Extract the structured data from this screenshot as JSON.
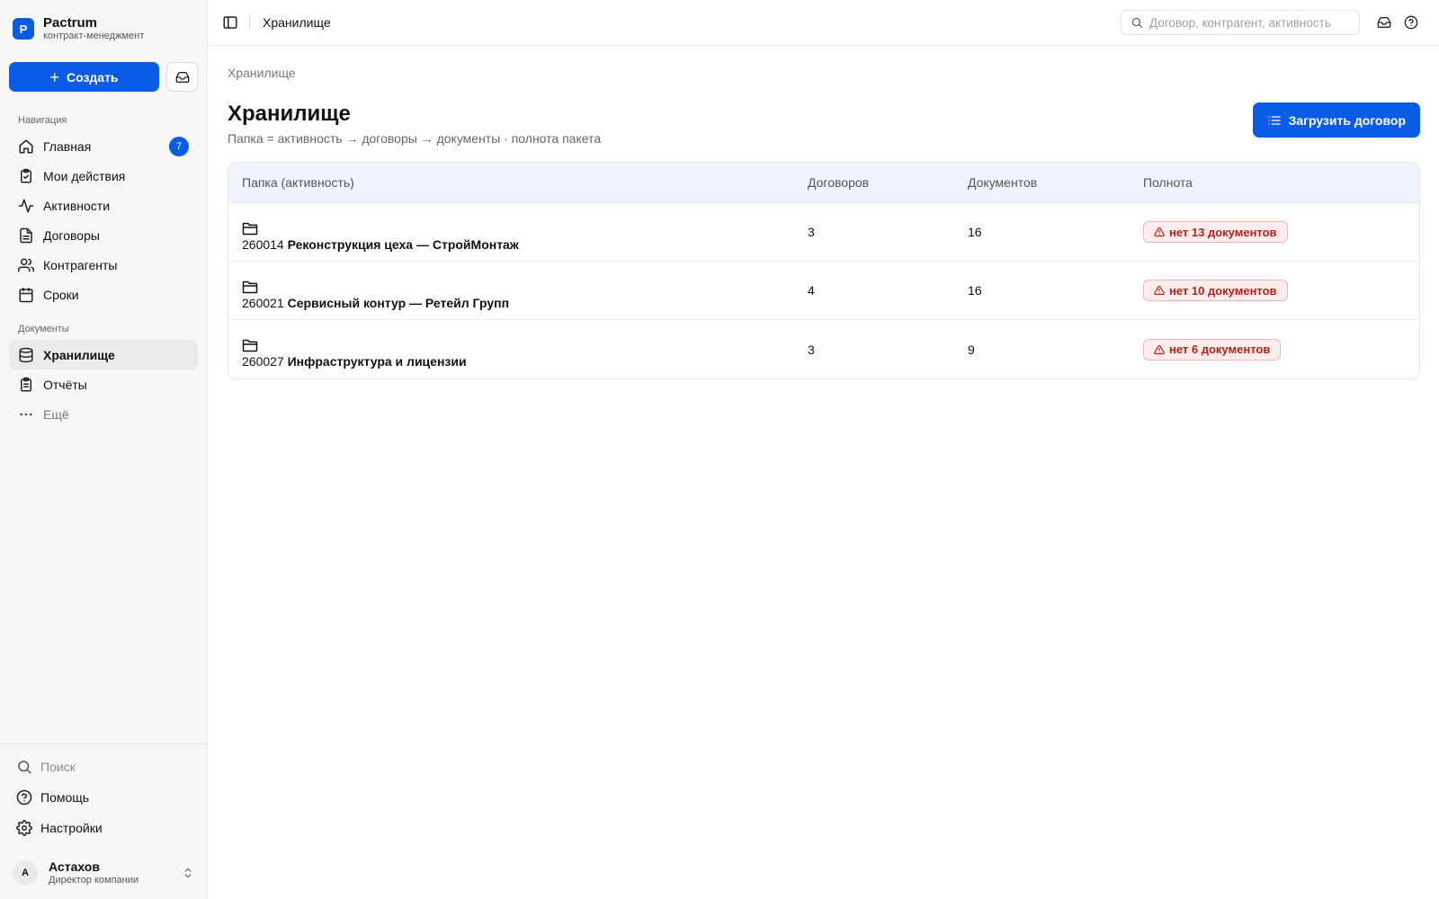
{
  "brand": {
    "logo_letter": "P",
    "name": "Pactrum",
    "subtitle": "контракт-менеджмент"
  },
  "sidebar": {
    "create_label": "Создать",
    "nav_section_label": "Навигация",
    "nav_items": [
      {
        "label": "Главная",
        "icon": "home-icon",
        "badge": "7"
      },
      {
        "label": "Мои действия",
        "icon": "clipboard-check-icon"
      },
      {
        "label": "Активности",
        "icon": "activity-icon"
      },
      {
        "label": "Договоры",
        "icon": "file-text-icon"
      },
      {
        "label": "Контрагенты",
        "icon": "users-icon"
      },
      {
        "label": "Сроки",
        "icon": "calendar-icon"
      }
    ],
    "docs_section_label": "Документы",
    "doc_items": [
      {
        "label": "Хранилище",
        "icon": "database-icon",
        "active": true
      },
      {
        "label": "Отчёты",
        "icon": "clipboard-list-icon"
      },
      {
        "label": "Ещё",
        "icon": "more-horizontal-icon"
      }
    ],
    "bottom_items": [
      {
        "label": "Поиск",
        "icon": "search-icon"
      },
      {
        "label": "Помощь",
        "icon": "help-circle-icon"
      },
      {
        "label": "Настройки",
        "icon": "settings-icon"
      }
    ],
    "user": {
      "initial": "А",
      "name": "Астахов",
      "role": "Директор компании"
    }
  },
  "topbar": {
    "title": "Хранилище",
    "search_placeholder": "Договор, контрагент, активность"
  },
  "page": {
    "breadcrumb": "Хранилище",
    "title": "Хранилище",
    "subtitle": "Папка = активность → договоры → документы · полнота пакета",
    "upload_label": "Загрузить договор"
  },
  "table": {
    "columns": [
      "Папка (активность)",
      "Договоров",
      "Документов",
      "Полнота"
    ],
    "rows": [
      {
        "code": "260014",
        "name": "Реконструкция цеха — СтройМонтаж",
        "contracts": "3",
        "documents": "16",
        "completeness": "нет 13 документов"
      },
      {
        "code": "260021",
        "name": "Сервисный контур — Ретейл Групп",
        "contracts": "4",
        "documents": "16",
        "completeness": "нет 10 документов"
      },
      {
        "code": "260027",
        "name": "Инфраструктура и лицензии",
        "contracts": "3",
        "documents": "9",
        "completeness": "нет 6 документов"
      }
    ]
  },
  "colors": {
    "accent": "#0a5ce6",
    "warning_text": "#b42318",
    "warning_bg": "#fdecec",
    "table_header_bg": "#eef3fd"
  }
}
